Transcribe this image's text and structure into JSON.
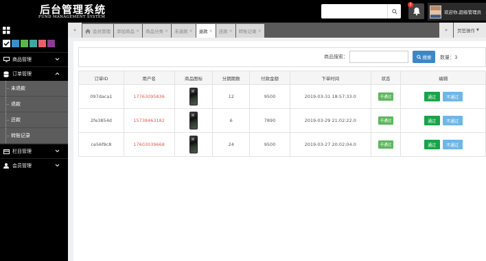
{
  "header": {
    "title": "后台管理系统",
    "subtitle": "FUND MANAGEMENT SYSTEM",
    "search_placeholder": "",
    "notification_count": "3",
    "user_greeting": "欢迎你,超级管理员"
  },
  "sidebar": {
    "swatches": [
      "#ffffff",
      "#3a8fc8",
      "#58b947",
      "#3ea8a0",
      "#e8606a",
      "#8a3c92"
    ],
    "menu": [
      {
        "label": "商品管理"
      },
      {
        "label": "订单管理"
      },
      {
        "label": "栏目管理"
      },
      {
        "label": "会员管理"
      }
    ],
    "submenu": [
      {
        "label": "未退款"
      },
      {
        "label": "退款"
      },
      {
        "label": "还款"
      },
      {
        "label": "转账记录"
      }
    ]
  },
  "tabs": [
    {
      "label": "会员管理"
    },
    {
      "label": "添加商品"
    },
    {
      "label": "商品分类"
    },
    {
      "label": "未退款"
    },
    {
      "label": "退款"
    },
    {
      "label": "还款"
    },
    {
      "label": "转账记录"
    }
  ],
  "page_ops": "页签操作",
  "filter": {
    "label": "商品搜索：",
    "search_button": "搜索",
    "count_label": "数量：3"
  },
  "table": {
    "columns": [
      "订单ID",
      "用户名",
      "商品图标",
      "分期期数",
      "付款金额",
      "下单时间",
      "状态",
      "编辑"
    ],
    "rows": [
      {
        "id": "097daca1",
        "user": "17763095836",
        "periods": "12",
        "amount": "9500",
        "time": "2019-03-31 18:57:33.0",
        "status": "不通过"
      },
      {
        "id": "2fe3854d",
        "user": "15738463182",
        "periods": "6",
        "amount": "7890",
        "time": "2019-03-29 21:02:22.0",
        "status": "不通过"
      },
      {
        "id": "ce56f9c8",
        "user": "17603039668",
        "periods": "24",
        "amount": "9500",
        "time": "2019-03-27 20:02:04.0",
        "status": "不通过"
      }
    ],
    "pass_label": "通过",
    "fail_label": "不通过"
  }
}
